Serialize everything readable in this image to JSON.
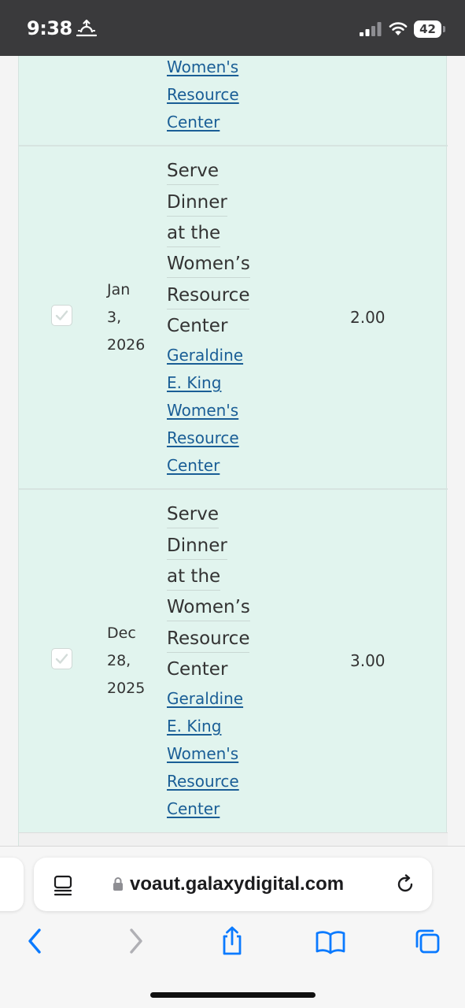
{
  "status_bar": {
    "time": "9:38",
    "battery_level": "42",
    "icons": [
      "sunrise-icon",
      "signal-icon",
      "wifi-icon",
      "battery-icon"
    ]
  },
  "table": {
    "partial_row": {
      "org_link_lines": [
        "Women's",
        "Resource",
        "Center"
      ]
    },
    "rows": [
      {
        "checked": true,
        "date_lines": [
          "Jan",
          "3,",
          "2026"
        ],
        "title_lines": [
          "Serve",
          "Dinner",
          "at the",
          "Women’s",
          "Resource",
          "Center"
        ],
        "org_link_lines": [
          "Geraldine",
          "E. King",
          "Women's",
          "Resource",
          "Center"
        ],
        "hours": "2.00"
      },
      {
        "checked": true,
        "date_lines": [
          "Dec",
          "28,",
          "2025"
        ],
        "title_lines": [
          "Serve",
          "Dinner",
          "at the",
          "Women’s",
          "Resource",
          "Center"
        ],
        "org_link_lines": [
          "Geraldine",
          "E. King",
          "Women's",
          "Resource",
          "Center"
        ],
        "hours": "3.00"
      }
    ]
  },
  "browser": {
    "url": "voaut.galaxydigital.com",
    "icons": [
      "reader-icon",
      "lock-icon",
      "reload-icon",
      "back-icon",
      "forward-icon",
      "share-icon",
      "bookmarks-icon",
      "tabs-icon"
    ],
    "colors": {
      "accent": "#0a7aff",
      "disabled": "#b0b0b5"
    }
  },
  "colors": {
    "row_background": "#e1f4ee",
    "link": "#1a5e96",
    "text": "#333333",
    "status_bar": "#3a3a3c"
  }
}
